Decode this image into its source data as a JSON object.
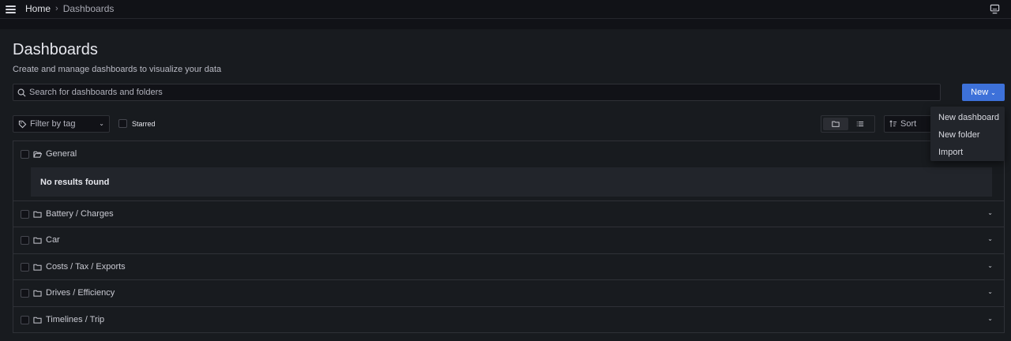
{
  "topbar": {
    "breadcrumb_home": "Home",
    "breadcrumb_separator": "›",
    "breadcrumb_current": "Dashboards"
  },
  "page": {
    "title": "Dashboards",
    "subtitle": "Create and manage dashboards to visualize your data"
  },
  "search": {
    "placeholder": "Search for dashboards and folders"
  },
  "toolbar": {
    "new_label": "New",
    "filter_tag_label": "Filter by tag",
    "starred_label": "Starred",
    "sort_label": "Sort",
    "active_view": "folder-view"
  },
  "new_menu": {
    "items": [
      "New dashboard",
      "New folder",
      "Import"
    ]
  },
  "folders": [
    {
      "label": "General",
      "expanded": true,
      "empty_text": "No results found"
    },
    {
      "label": "Battery / Charges",
      "expanded": false
    },
    {
      "label": "Car",
      "expanded": false
    },
    {
      "label": "Costs / Tax / Exports",
      "expanded": false
    },
    {
      "label": "Drives / Efficiency",
      "expanded": false
    },
    {
      "label": "Timelines / Trip",
      "expanded": false
    }
  ],
  "colors": {
    "background": "#181b1f",
    "topbar": "#111217",
    "primary": "#3d71d9",
    "border": "#2f3137"
  }
}
